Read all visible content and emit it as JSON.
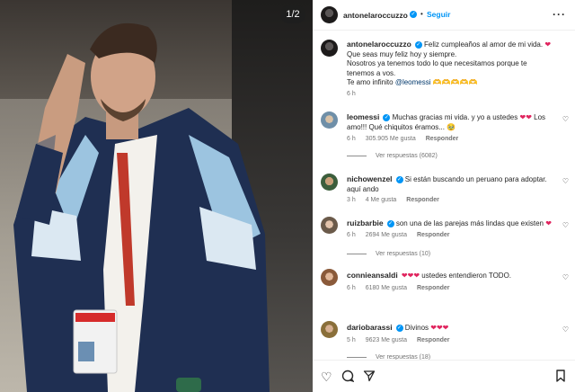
{
  "media": {
    "counter": "1/2"
  },
  "header": {
    "username": "antonelaroccuzzo",
    "dot": "•",
    "follow_label": "Seguir",
    "more": "···"
  },
  "caption": {
    "username": "antonelaroccuzzo",
    "line1": "Feliz cumpleaños al amor de mi vida.",
    "line2": "Que seas muy feliz hoy y siempre.",
    "line3": "Nosotros ya tenemos todo lo que necesitamos porque te",
    "line4": "tenemos a vos.",
    "line5": "Te amo infinito",
    "mention": "@leomessi",
    "emoji_tail": "🫶🫶🫶🫶🫶",
    "time": "6 h"
  },
  "comments": [
    {
      "username": "leomessi",
      "text_a": "Muchas gracias mi vida. y yo a ustedes",
      "text_b": "Los",
      "text_c": "amo!!! Qué chiquitos éramos...",
      "time": "6 h",
      "likes": "305.905 Me gusta",
      "reply": "Responder",
      "view_replies": "Ver respuestas (6082)"
    },
    {
      "username": "nichowenzel",
      "text_a": "Si están buscando un peruano para adoptar.",
      "text_c": "aquí ando",
      "time": "3 h",
      "likes": "4 Me gusta",
      "reply": "Responder"
    },
    {
      "username": "ruizbarbie",
      "text_a": "son una de las parejas más lindas que existen",
      "time": "6 h",
      "likes": "2694 Me gusta",
      "reply": "Responder",
      "view_replies": "Ver respuestas (10)"
    },
    {
      "username": "connieansaldi",
      "text_a": "ustedes entendieron TODO.",
      "time": "6 h",
      "likes": "6180 Me gusta",
      "reply": "Responder"
    },
    {
      "username": "dariobarassi",
      "text_a": "Divinos",
      "time": "5 h",
      "likes": "9623 Me gusta",
      "reply": "Responder",
      "view_replies": "Ver respuestas (18)"
    }
  ]
}
